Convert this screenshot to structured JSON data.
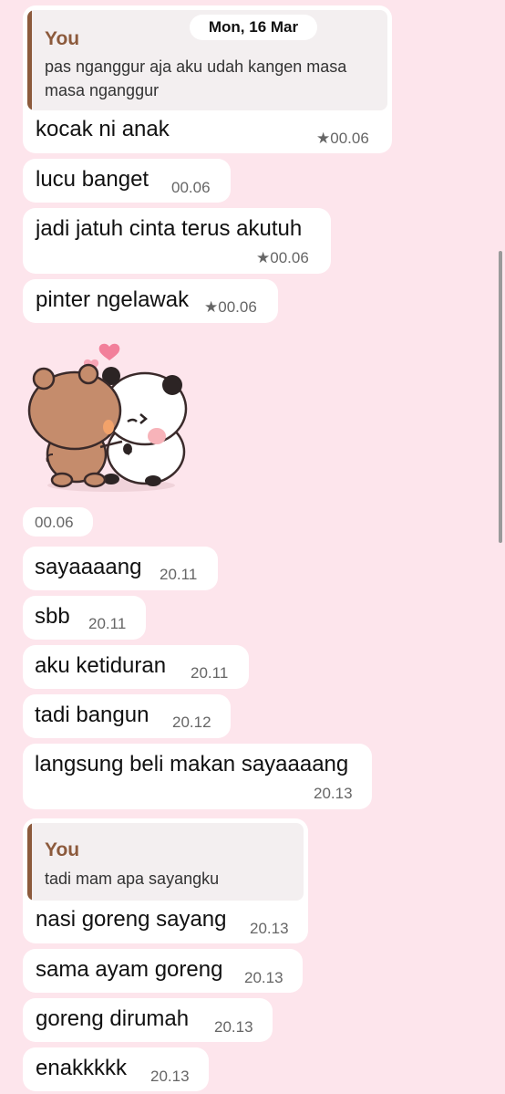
{
  "date_divider": "Mon, 16 Mar",
  "messages": [
    {
      "quote": {
        "author": "You",
        "lines": [
          "pas nganggur aja aku udah kangen masa",
          "masa nganggur"
        ]
      },
      "text": "kocak ni anak",
      "time": "00.06",
      "starred": true
    },
    {
      "text": "lucu banget",
      "time": "00.06",
      "starred": false
    },
    {
      "text": "jadi jatuh cinta terus akutuh",
      "time": "00.06",
      "starred": true
    },
    {
      "text": "pinter ngelawak",
      "time": "00.06",
      "starred": true
    },
    {
      "sticker": "bear-and-panda-hug-sticker",
      "time": "00.06"
    },
    {
      "text": "sayaaaang",
      "time": "20.11"
    },
    {
      "text": "sbb",
      "time": "20.11"
    },
    {
      "text": "aku ketiduran",
      "time": "20.11"
    },
    {
      "text": "tadi bangun",
      "time": "20.12"
    },
    {
      "text": "langsung beli makan sayaaaang",
      "time": "20.13"
    },
    {
      "quote": {
        "author": "You",
        "lines": [
          "tadi mam apa sayangku"
        ]
      },
      "text": "nasi goreng sayang",
      "time": "20.13"
    },
    {
      "text": "sama ayam goreng",
      "time": "20.13"
    },
    {
      "text": "goreng dirumah",
      "time": "20.13"
    },
    {
      "text": "enakkkkk",
      "time": "20.13"
    }
  ],
  "icons": {
    "star": "star-icon",
    "sticker": "bear-and-panda-hug-sticker"
  },
  "colors": {
    "background": "#fde5ec",
    "bubble": "#ffffff",
    "quote_accent": "#8c5a3c",
    "quote_bg": "#f3eff0",
    "time": "#666666"
  }
}
